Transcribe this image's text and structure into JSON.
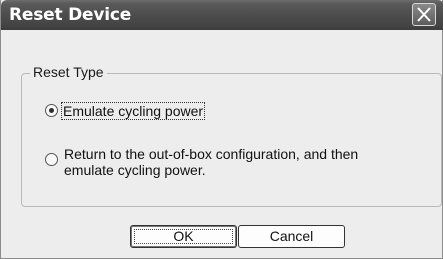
{
  "dialog": {
    "title": "Reset Device",
    "close_icon": "close-x-icon"
  },
  "reset_type": {
    "legend": "Reset Type",
    "options": [
      {
        "label": "Emulate cycling power",
        "selected": true
      },
      {
        "label_line1": "Return to the out-of-box configuration, and then",
        "label_line2": "emulate cycling power.",
        "selected": false
      }
    ]
  },
  "buttons": {
    "ok_label": "OK",
    "cancel_label": "Cancel"
  }
}
